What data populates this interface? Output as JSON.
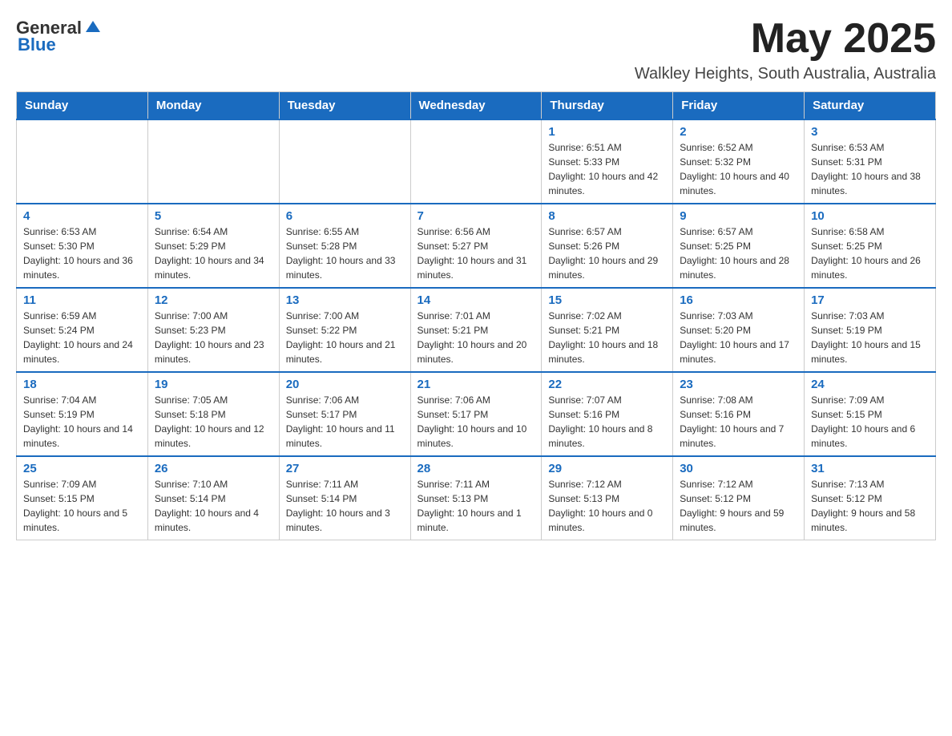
{
  "header": {
    "logo_general": "General",
    "logo_blue": "Blue",
    "month_title": "May 2025",
    "location": "Walkley Heights, South Australia, Australia"
  },
  "days_of_week": [
    "Sunday",
    "Monday",
    "Tuesday",
    "Wednesday",
    "Thursday",
    "Friday",
    "Saturday"
  ],
  "weeks": [
    [
      {
        "day": "",
        "info": ""
      },
      {
        "day": "",
        "info": ""
      },
      {
        "day": "",
        "info": ""
      },
      {
        "day": "",
        "info": ""
      },
      {
        "day": "1",
        "info": "Sunrise: 6:51 AM\nSunset: 5:33 PM\nDaylight: 10 hours and 42 minutes."
      },
      {
        "day": "2",
        "info": "Sunrise: 6:52 AM\nSunset: 5:32 PM\nDaylight: 10 hours and 40 minutes."
      },
      {
        "day": "3",
        "info": "Sunrise: 6:53 AM\nSunset: 5:31 PM\nDaylight: 10 hours and 38 minutes."
      }
    ],
    [
      {
        "day": "4",
        "info": "Sunrise: 6:53 AM\nSunset: 5:30 PM\nDaylight: 10 hours and 36 minutes."
      },
      {
        "day": "5",
        "info": "Sunrise: 6:54 AM\nSunset: 5:29 PM\nDaylight: 10 hours and 34 minutes."
      },
      {
        "day": "6",
        "info": "Sunrise: 6:55 AM\nSunset: 5:28 PM\nDaylight: 10 hours and 33 minutes."
      },
      {
        "day": "7",
        "info": "Sunrise: 6:56 AM\nSunset: 5:27 PM\nDaylight: 10 hours and 31 minutes."
      },
      {
        "day": "8",
        "info": "Sunrise: 6:57 AM\nSunset: 5:26 PM\nDaylight: 10 hours and 29 minutes."
      },
      {
        "day": "9",
        "info": "Sunrise: 6:57 AM\nSunset: 5:25 PM\nDaylight: 10 hours and 28 minutes."
      },
      {
        "day": "10",
        "info": "Sunrise: 6:58 AM\nSunset: 5:25 PM\nDaylight: 10 hours and 26 minutes."
      }
    ],
    [
      {
        "day": "11",
        "info": "Sunrise: 6:59 AM\nSunset: 5:24 PM\nDaylight: 10 hours and 24 minutes."
      },
      {
        "day": "12",
        "info": "Sunrise: 7:00 AM\nSunset: 5:23 PM\nDaylight: 10 hours and 23 minutes."
      },
      {
        "day": "13",
        "info": "Sunrise: 7:00 AM\nSunset: 5:22 PM\nDaylight: 10 hours and 21 minutes."
      },
      {
        "day": "14",
        "info": "Sunrise: 7:01 AM\nSunset: 5:21 PM\nDaylight: 10 hours and 20 minutes."
      },
      {
        "day": "15",
        "info": "Sunrise: 7:02 AM\nSunset: 5:21 PM\nDaylight: 10 hours and 18 minutes."
      },
      {
        "day": "16",
        "info": "Sunrise: 7:03 AM\nSunset: 5:20 PM\nDaylight: 10 hours and 17 minutes."
      },
      {
        "day": "17",
        "info": "Sunrise: 7:03 AM\nSunset: 5:19 PM\nDaylight: 10 hours and 15 minutes."
      }
    ],
    [
      {
        "day": "18",
        "info": "Sunrise: 7:04 AM\nSunset: 5:19 PM\nDaylight: 10 hours and 14 minutes."
      },
      {
        "day": "19",
        "info": "Sunrise: 7:05 AM\nSunset: 5:18 PM\nDaylight: 10 hours and 12 minutes."
      },
      {
        "day": "20",
        "info": "Sunrise: 7:06 AM\nSunset: 5:17 PM\nDaylight: 10 hours and 11 minutes."
      },
      {
        "day": "21",
        "info": "Sunrise: 7:06 AM\nSunset: 5:17 PM\nDaylight: 10 hours and 10 minutes."
      },
      {
        "day": "22",
        "info": "Sunrise: 7:07 AM\nSunset: 5:16 PM\nDaylight: 10 hours and 8 minutes."
      },
      {
        "day": "23",
        "info": "Sunrise: 7:08 AM\nSunset: 5:16 PM\nDaylight: 10 hours and 7 minutes."
      },
      {
        "day": "24",
        "info": "Sunrise: 7:09 AM\nSunset: 5:15 PM\nDaylight: 10 hours and 6 minutes."
      }
    ],
    [
      {
        "day": "25",
        "info": "Sunrise: 7:09 AM\nSunset: 5:15 PM\nDaylight: 10 hours and 5 minutes."
      },
      {
        "day": "26",
        "info": "Sunrise: 7:10 AM\nSunset: 5:14 PM\nDaylight: 10 hours and 4 minutes."
      },
      {
        "day": "27",
        "info": "Sunrise: 7:11 AM\nSunset: 5:14 PM\nDaylight: 10 hours and 3 minutes."
      },
      {
        "day": "28",
        "info": "Sunrise: 7:11 AM\nSunset: 5:13 PM\nDaylight: 10 hours and 1 minute."
      },
      {
        "day": "29",
        "info": "Sunrise: 7:12 AM\nSunset: 5:13 PM\nDaylight: 10 hours and 0 minutes."
      },
      {
        "day": "30",
        "info": "Sunrise: 7:12 AM\nSunset: 5:12 PM\nDaylight: 9 hours and 59 minutes."
      },
      {
        "day": "31",
        "info": "Sunrise: 7:13 AM\nSunset: 5:12 PM\nDaylight: 9 hours and 58 minutes."
      }
    ]
  ]
}
